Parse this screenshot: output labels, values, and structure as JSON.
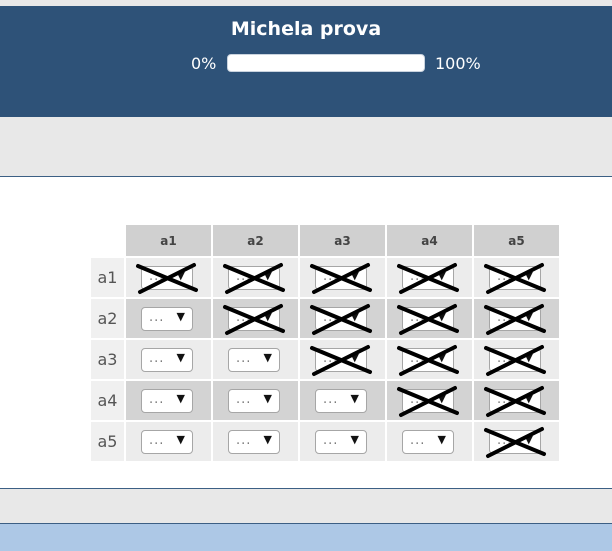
{
  "header": {
    "title": "Michela prova",
    "progress_min_label": "0%",
    "progress_max_label": "100%",
    "progress_value": 0
  },
  "matrix": {
    "columns": [
      "a1",
      "a2",
      "a3",
      "a4",
      "a5"
    ],
    "rows": [
      {
        "label": "a1",
        "cells": [
          {
            "value": "...",
            "crossed": true
          },
          {
            "value": "...",
            "crossed": true
          },
          {
            "value": "...",
            "crossed": true
          },
          {
            "value": "...",
            "crossed": true
          },
          {
            "value": "...",
            "crossed": true
          }
        ]
      },
      {
        "label": "a2",
        "cells": [
          {
            "value": "...",
            "crossed": false
          },
          {
            "value": "...",
            "crossed": true
          },
          {
            "value": "...",
            "crossed": true
          },
          {
            "value": "...",
            "crossed": true
          },
          {
            "value": "...",
            "crossed": true
          }
        ]
      },
      {
        "label": "a3",
        "cells": [
          {
            "value": "...",
            "crossed": false
          },
          {
            "value": "...",
            "crossed": false
          },
          {
            "value": "...",
            "crossed": true
          },
          {
            "value": "...",
            "crossed": true
          },
          {
            "value": "...",
            "crossed": true
          }
        ]
      },
      {
        "label": "a4",
        "cells": [
          {
            "value": "...",
            "crossed": false
          },
          {
            "value": "...",
            "crossed": false
          },
          {
            "value": "...",
            "crossed": false
          },
          {
            "value": "...",
            "crossed": true
          },
          {
            "value": "...",
            "crossed": true
          }
        ]
      },
      {
        "label": "a5",
        "cells": [
          {
            "value": "...",
            "crossed": false
          },
          {
            "value": "...",
            "crossed": false
          },
          {
            "value": "...",
            "crossed": false
          },
          {
            "value": "...",
            "crossed": false
          },
          {
            "value": "...",
            "crossed": true
          }
        ]
      }
    ]
  },
  "colors": {
    "header_bg": "#2e5278",
    "row_light": "#ececec",
    "row_dark": "#d3d3d3",
    "column_header_bg": "#d0d0d0",
    "bottom_bar": "#adc8e6"
  }
}
